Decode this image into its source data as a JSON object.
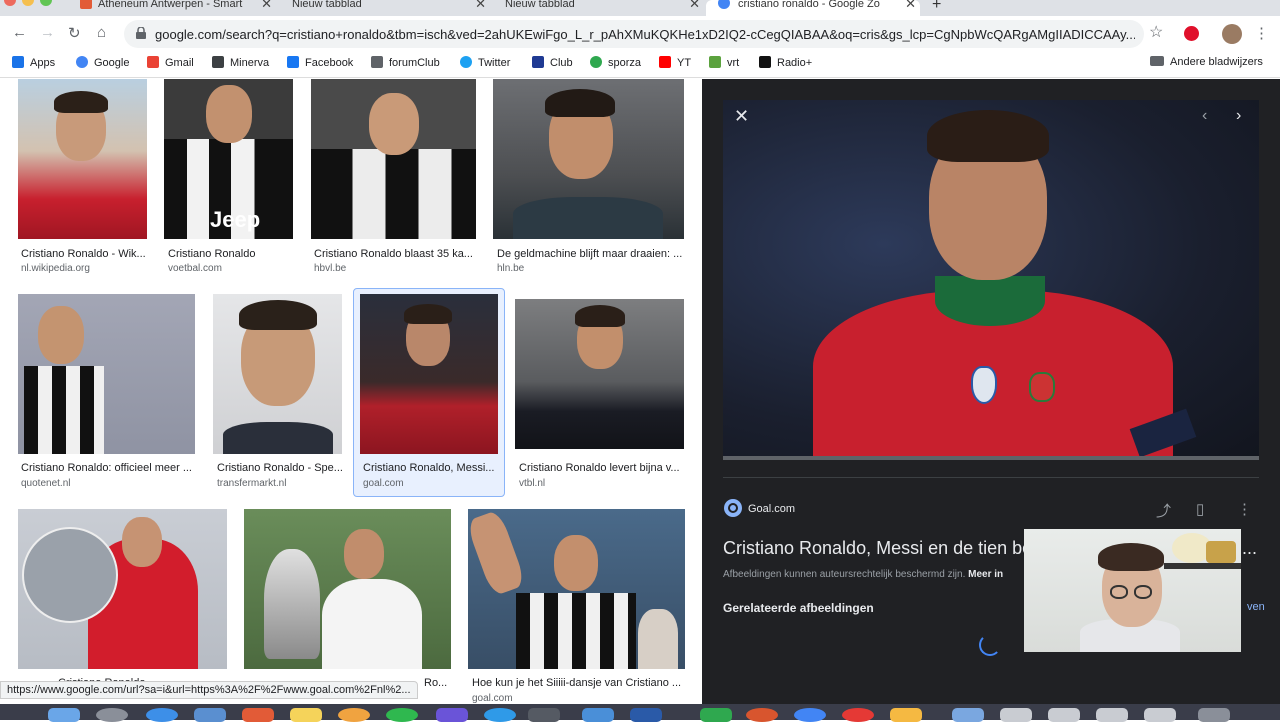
{
  "tabs": [
    {
      "label": "Atheneum Antwerpen - Smart",
      "close": "✕"
    },
    {
      "label": "Nieuw tabblad",
      "close": "✕"
    },
    {
      "label": "Nieuw tabblad",
      "close": "✕"
    },
    {
      "label": "cristiano ronaldo - Google Zo",
      "close": "✕"
    }
  ],
  "new_tab": "+",
  "toolbar": {
    "url": "google.com/search?q=cristiano+ronaldo&tbm=isch&ved=2ahUKEwiFgo_L_r_pAhXMuKQKHe1xD2IQ2-cCegQIABAA&oq=cris&gs_lcp=CgNpbWcQARgAMgIIADICCAAy..."
  },
  "bookmarks": [
    {
      "label": "Apps",
      "icon": "apps-grid-icon",
      "color": "#1a73e8"
    },
    {
      "label": "Google",
      "icon": "google-icon",
      "color": "#4285f4"
    },
    {
      "label": "Gmail",
      "icon": "gmail-icon",
      "color": "#ea4335"
    },
    {
      "label": "Minerva",
      "icon": "minerva-icon",
      "color": "#3c4043"
    },
    {
      "label": "Facebook",
      "icon": "facebook-icon",
      "color": "#1877f2"
    },
    {
      "label": "forumClub",
      "icon": "forumclub-icon",
      "color": "#5f6368"
    },
    {
      "label": "Twitter",
      "icon": "twitter-icon",
      "color": "#1da1f2"
    },
    {
      "label": "Club",
      "icon": "club-icon",
      "color": "#1f3a93"
    },
    {
      "label": "sporza",
      "icon": "sporza-icon",
      "color": "#2fa84f"
    },
    {
      "label": "YT",
      "icon": "youtube-icon",
      "color": "#ff0000"
    },
    {
      "label": "vrt",
      "icon": "vrt-icon",
      "color": "#5ba23e"
    },
    {
      "label": "Radio+",
      "icon": "radio-plus-icon",
      "color": "#111111"
    }
  ],
  "other_bookmarks": "Andere bladwijzers",
  "results": [
    {
      "title": "Cristiano Ronaldo - Wik...",
      "source": "nl.wikipedia.org"
    },
    {
      "title": "Cristiano Ronaldo",
      "source": "voetbal.com"
    },
    {
      "title": "Cristiano Ronaldo blaast 35 ka...",
      "source": "hbvl.be"
    },
    {
      "title": "De geldmachine blijft maar draaien: ...",
      "source": "hln.be"
    },
    {
      "title": "Cristiano Ronaldo: officieel meer ...",
      "source": "quotenet.nl"
    },
    {
      "title": "Cristiano Ronaldo - Spe...",
      "source": "transfermarkt.nl"
    },
    {
      "title": "Cristiano Ronaldo, Messi...",
      "source": "goal.com"
    },
    {
      "title": "Cristiano Ronaldo levert bijna v...",
      "source": "vtbl.nl"
    },
    {
      "title": "Cristiano Ronaldo ...",
      "source": ""
    },
    {
      "title": "Ro...",
      "source": ""
    },
    {
      "title": "Hoe kun je het Siiiii-dansje van Cristiano ...",
      "source": "goal.com"
    }
  ],
  "preview": {
    "close": "✕",
    "prev": "‹",
    "next": "›",
    "source": "Goal.com",
    "title": "Cristiano Ronaldo, Messi en de tien be",
    "title_ellipsis": "...",
    "copyright": "Afbeeldingen kunnen auteursrechtelijk beschermd zijn.",
    "copyright_more": "Meer in",
    "related": "Gerelateerde afbeeldingen",
    "see_more": "ven"
  },
  "status_url": "https://www.google.com/url?sa=i&url=https%3A%2F%2Fwww.goal.com%2Fnl%2..."
}
